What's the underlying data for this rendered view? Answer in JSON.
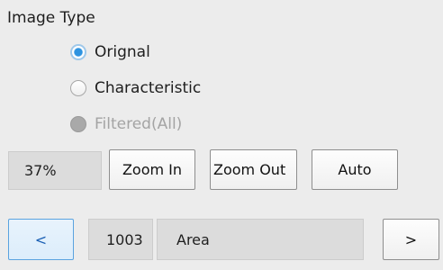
{
  "image_type": {
    "title": "Image Type",
    "options": [
      {
        "label": "Orignal",
        "state": "checked"
      },
      {
        "label": "Characteristic",
        "state": "unchecked"
      },
      {
        "label": "Filtered(All)",
        "state": "disabled"
      }
    ]
  },
  "zoom": {
    "level": "37%",
    "zoom_in_label": "Zoom In",
    "zoom_out_label": "Zoom Out",
    "auto_label": "Auto"
  },
  "navigation": {
    "prev_label": "<",
    "next_label": ">",
    "item_id": "1003",
    "item_name": "Area"
  },
  "colors": {
    "accent": "#2e93e0",
    "background": "#ececec",
    "disabled_text": "#a4a4a4"
  }
}
